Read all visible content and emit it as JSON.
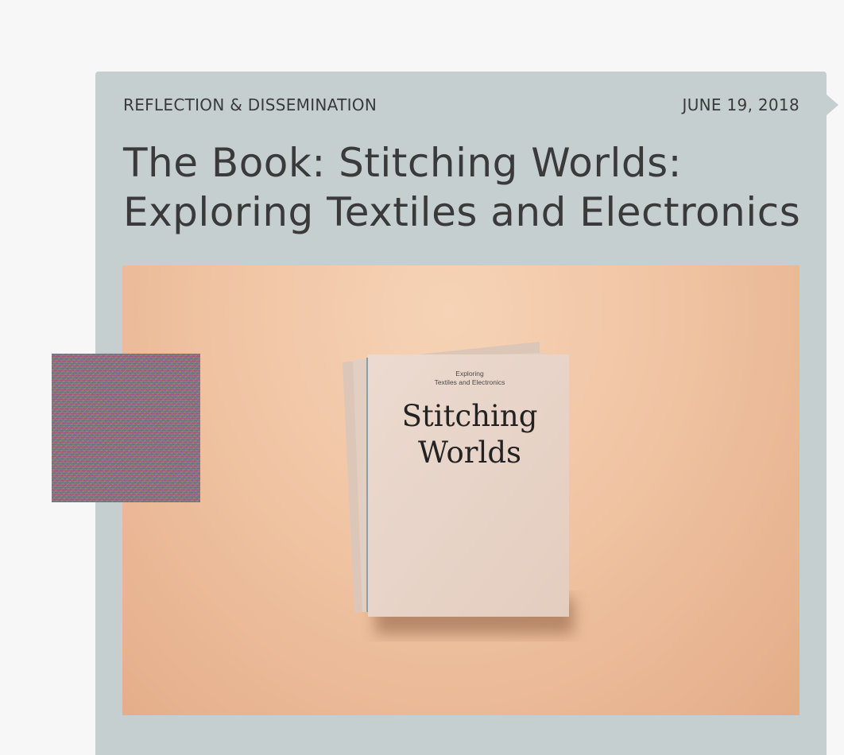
{
  "post": {
    "category": "REFLECTION & DISSEMINATION",
    "date": "JUNE 19, 2018",
    "title": "The Book: Stitching Worlds: Exploring Textiles and Electronics"
  },
  "hero_image": {
    "cover_small_text_line1": "Exploring",
    "cover_small_text_line2": "Textiles and Electronics",
    "cover_title_line1": "Stitching",
    "cover_title_line2": "Worlds"
  },
  "colors": {
    "page_background": "#f7f7f7",
    "card_background": "#c6cfcf",
    "text": "#3a3a3a",
    "image_background": "#f0c4a3",
    "book_cover": "#e9d6cb"
  }
}
